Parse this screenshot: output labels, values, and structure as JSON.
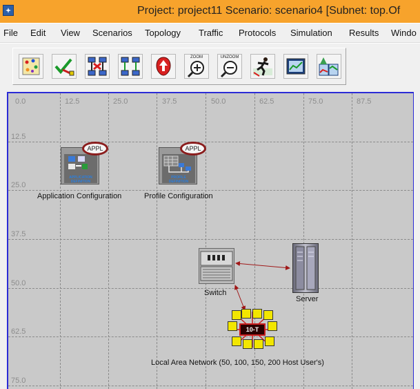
{
  "titlebar": {
    "title": "Project: project11 Scenario: scenario4  [Subnet: top.Of"
  },
  "menu": [
    "File",
    "Edit",
    "View",
    "Scenarios",
    "Topology",
    "Traffic",
    "Protocols",
    "Simulation",
    "Results",
    "Windo"
  ],
  "toolbar": {
    "buttons": [
      {
        "name": "open-object-palette-button",
        "icon": "palette-icon"
      },
      {
        "name": "verify-links-button",
        "icon": "checkmark-link-icon"
      },
      {
        "name": "fail-node-button",
        "icon": "fail-link-icon"
      },
      {
        "name": "recover-node-button",
        "icon": "recover-link-icon"
      },
      {
        "name": "return-to-parent-button",
        "icon": "parent-subnet-icon"
      },
      {
        "name": "zoom-button",
        "icon": "zoom-in-icon",
        "label": "ZOOM"
      },
      {
        "name": "unzoom-button",
        "icon": "zoom-out-icon",
        "label": "UNZOOM"
      },
      {
        "name": "configure-run-simulation-button",
        "icon": "running-man-icon"
      },
      {
        "name": "view-results-button",
        "icon": "results-graph-icon"
      },
      {
        "name": "hide-show-graphs-button",
        "icon": "graph-panels-icon"
      }
    ]
  },
  "grid": {
    "x_ticks": [
      "0.0",
      "12.5",
      "25.0",
      "37.5",
      "50.0",
      "62.5",
      "75.0",
      "87.5"
    ],
    "y_ticks": [
      "12.5",
      "25.0",
      "37.5",
      "50.0",
      "62.5",
      "75.0"
    ]
  },
  "nodes": {
    "app_config": {
      "label": "Application Configuration",
      "badge": "APPL",
      "caption": [
        "APPLICATION",
        "DEFINITION"
      ]
    },
    "profile_config": {
      "label": "Profile Configuration",
      "badge": "APPL",
      "caption": [
        "PROFILE",
        "DEFINITION"
      ]
    },
    "switch": {
      "label": "Switch"
    },
    "server": {
      "label": "Server"
    },
    "lan": {
      "label": "Local Area Network (50, 100, 150, 200 Host User's)",
      "core_text": "10-T"
    }
  },
  "colors": {
    "titlebar": "#f7a32c",
    "canvas": "#c9c9c9",
    "canvas_border": "#2b2bd6",
    "link": "#a01818"
  }
}
